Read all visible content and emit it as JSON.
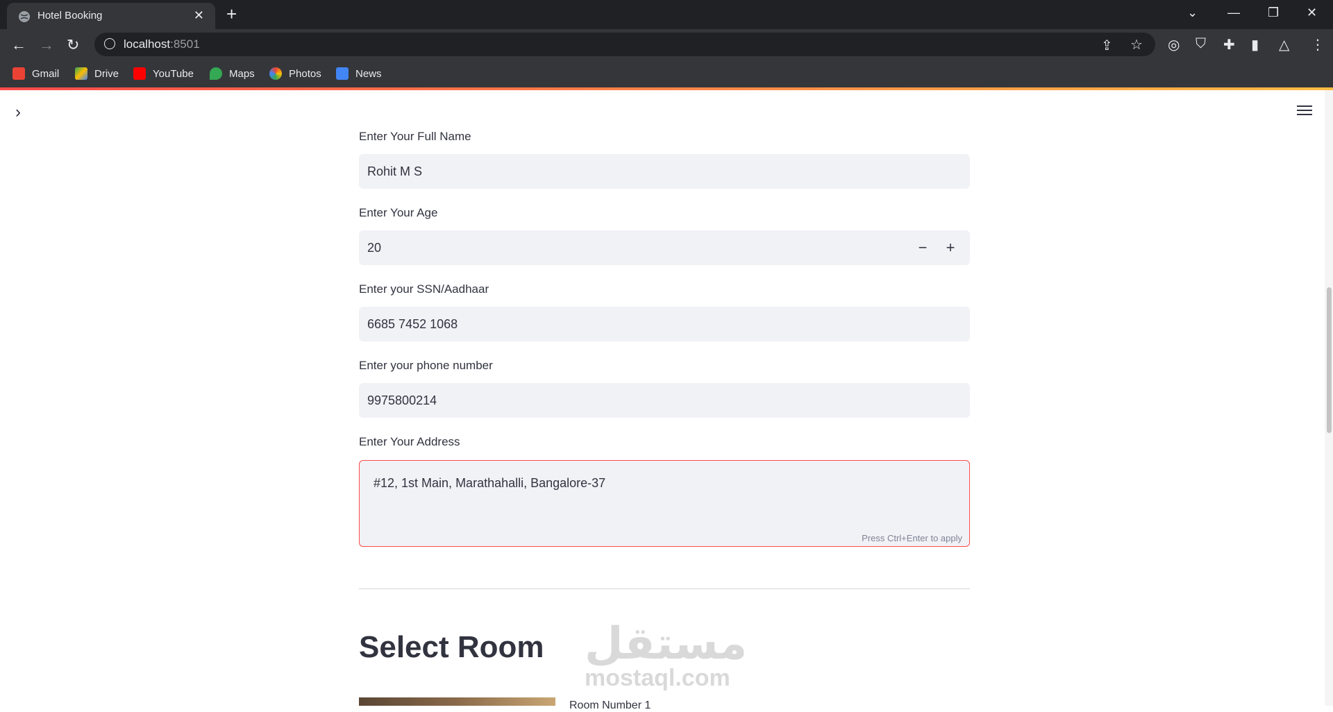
{
  "browser": {
    "tab_title": "Hotel Booking",
    "url_host": "localhost",
    "url_port": ":8501",
    "bookmarks": [
      "Gmail",
      "Drive",
      "YouTube",
      "Maps",
      "Photos",
      "News"
    ]
  },
  "form": {
    "full_name": {
      "label": "Enter Your Full Name",
      "value": "Rohit M S"
    },
    "age": {
      "label": "Enter Your Age",
      "value": "20",
      "minus": "−",
      "plus": "+"
    },
    "ssn": {
      "label": "Enter your SSN/Aadhaar",
      "value": "6685 7452 1068"
    },
    "phone": {
      "label": "Enter your phone number",
      "value": "9975800214"
    },
    "address": {
      "label": "Enter Your Address",
      "value": "#12, 1st Main, Marathahalli, Bangalore-37",
      "hint": "Press Ctrl+Enter to apply"
    }
  },
  "section": {
    "title": "Select Room",
    "room_number_label": "Room Number 1"
  },
  "watermark": {
    "arabic": "مستقل",
    "latin": "mostaql.com"
  }
}
